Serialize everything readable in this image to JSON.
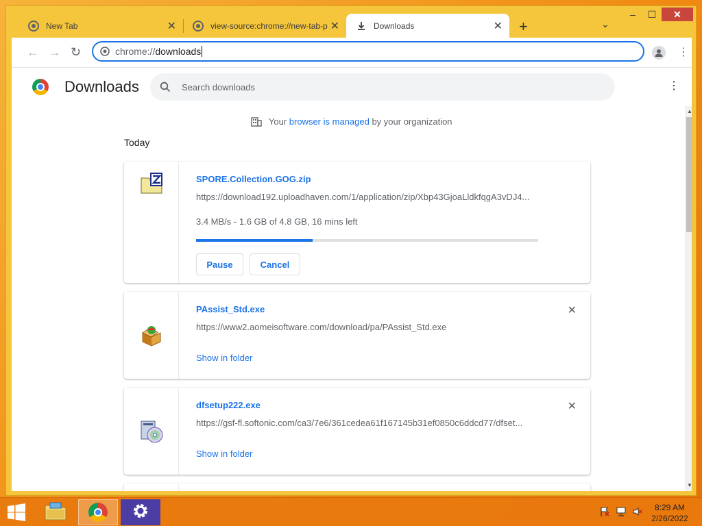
{
  "tabs": [
    {
      "title": "New Tab",
      "icon": "chrome-favicon-icon"
    },
    {
      "title": "view-source:chrome://new-tab-p",
      "icon": "chrome-favicon-icon"
    },
    {
      "title": "Downloads",
      "icon": "download-icon"
    }
  ],
  "new_tab_symbol": "+",
  "window_controls": {
    "minimize": "‒",
    "maximize": "☐",
    "close": "✕"
  },
  "toolbar": {
    "back": "←",
    "forward": "→",
    "reload": "↻",
    "address_scheme": "chrome://",
    "address_path": "downloads"
  },
  "page": {
    "title": "Downloads",
    "search_placeholder": "Search downloads",
    "managed_prefix": "Your",
    "managed_link": "browser is managed",
    "managed_suffix": "by your organization",
    "section_label": "Today"
  },
  "downloads": [
    {
      "filename": "SPORE.Collection.GOG.zip",
      "url": "https://download192.uploadhaven.com/1/application/zip/Xbp43GjoaLldkfqgA3vDJ4...",
      "status": "3.4 MB/s - 1.6 GB of 4.8 GB, 16 mins left",
      "progress": 0.34,
      "pause_label": "Pause",
      "cancel_label": "Cancel",
      "icon": "zip-file-icon"
    },
    {
      "filename": "PAssist_Std.exe",
      "url": "https://www2.aomeisoftware.com/download/pa/PAssist_Std.exe",
      "link_label": "Show in folder",
      "icon": "installer-box-icon"
    },
    {
      "filename": "dfsetup222.exe",
      "url": "https://gsf-fl.softonic.com/ca3/7e6/361cedea61f167145b31ef0850c6ddcd77/dfset...",
      "link_label": "Show in folder",
      "icon": "setup-disc-icon"
    }
  ],
  "close_symbol": "✕",
  "taskbar": {
    "time": "8:29 AM",
    "date": "2/26/2022"
  },
  "colors": {
    "accent": "#1a73e8",
    "window_frame": "#f5c53b",
    "taskbar": "#e87a0e"
  }
}
